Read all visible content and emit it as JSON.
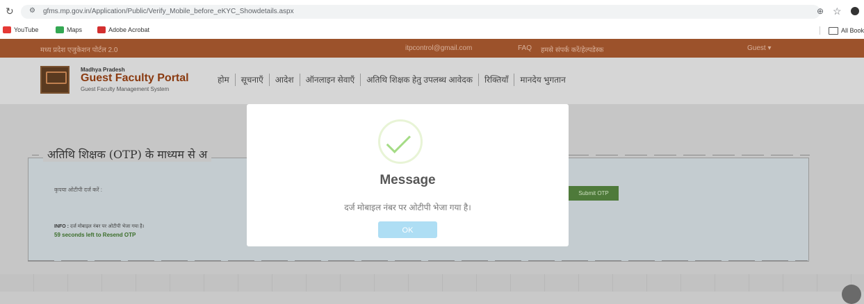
{
  "browser": {
    "url": "gfms.mp.gov.in/Application/Public/Verify_Mobile_before_eKYC_Showdetails.aspx",
    "bookmarks": [
      {
        "label": "YouTube",
        "color": "#e53935"
      },
      {
        "label": "Maps",
        "color": "#34a853"
      },
      {
        "label": "Adobe Acrobat",
        "color": "#d32f2f"
      }
    ],
    "all_bookmarks": "All Book"
  },
  "page": {
    "portal_name": "मध्य प्रदेश एजुकेशन पोर्टल 2.0",
    "email": "itpcontrol@gmail.com",
    "faq": "FAQ",
    "contact": "हमसे संपर्क करें/हेल्पडेस्क",
    "guest": "Guest ▾",
    "logo_line1": "Madhya Pradesh",
    "logo_line2": "Guest Faculty Portal",
    "logo_line3": "Guest Faculty Management System",
    "menu": [
      "होम",
      "सूचनाएँ",
      "आदेश",
      "ऑनलाइन सेवाएँ",
      "अतिथि शिक्षक हेतु उपलब्ध आवेदक",
      "रिक्तियाँ",
      "मानदेय भुगतान"
    ],
    "section_title": "अतिथि शिक्षक (OTP) के माध्यम से अ",
    "otp_label": "कृपया ओटीपी दर्ज करें :",
    "otp_button": "Submit OTP",
    "info_prefix": "INFO :",
    "info_text": "दर्ज मोबाइल नंबर पर ओटीपी भेजा गया है।",
    "countdown": "59 seconds left to Resend OTP"
  },
  "modal": {
    "title": "Message",
    "text": "दर्ज मोबाइल नंबर पर ओटीपी भेजा गया है।",
    "ok_label": "OK",
    "accent": "#a5dc86"
  }
}
